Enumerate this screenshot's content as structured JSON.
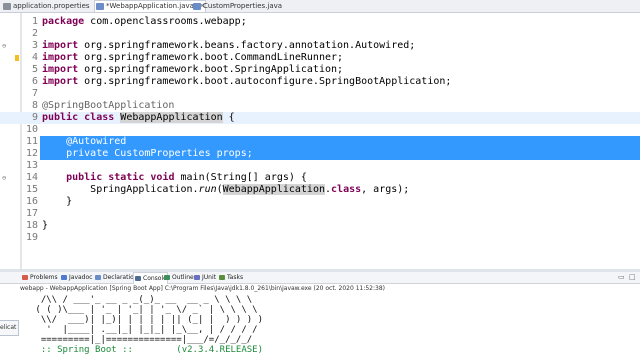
{
  "editor_tabs": [
    {
      "label": "application.properties",
      "icon": "properties-file-icon",
      "color": "#8a8f99"
    },
    {
      "label": "*WebappApplication.java",
      "icon": "java-file-icon",
      "color": "#6a8dc9"
    },
    {
      "label": "CustomProperties.java",
      "icon": "java-file-icon",
      "color": "#6a8dc9"
    }
  ],
  "tab_close_glyph": "✕",
  "code": {
    "l1": {
      "num": "1",
      "kw": "package",
      "rest": " com.openclassrooms.webapp;"
    },
    "l2": {
      "num": "2"
    },
    "l3": {
      "num": "3",
      "kw": "import",
      "rest": " org.springframework.beans.factory.annotation.Autowired;"
    },
    "l4": {
      "num": "4",
      "kw": "import",
      "rest": " org.springframework.boot.CommandLineRunner;"
    },
    "l5": {
      "num": "5",
      "kw": "import",
      "rest": " org.springframework.boot.SpringApplication;"
    },
    "l6": {
      "num": "6",
      "kw": "import",
      "rest": " org.springframework.boot.autoconfigure.SpringBootApplication;"
    },
    "l7": {
      "num": "7"
    },
    "l8": {
      "num": "8",
      "annotation": "@SpringBootApplication"
    },
    "l9": {
      "num": "9",
      "kw1": "public",
      "kw2": "class",
      "name": "WebappApplication",
      "rest": " {"
    },
    "l10": {
      "num": "10"
    },
    "l11": {
      "num": "11",
      "annotation": "@Autowired"
    },
    "l12": {
      "num": "12",
      "kw": "private",
      "type": " CustomProperties ",
      "field": "props",
      "rest": ";"
    },
    "l13": {
      "num": "13"
    },
    "l14": {
      "num": "14",
      "kw1": "public",
      "kw2": "static",
      "kw3": "void",
      "rest": " main(String[] args) {"
    },
    "l15": {
      "num": "15",
      "pre": "SpringApplication.",
      "method": "run",
      "paren": "(",
      "name": "WebappApplication",
      "kw": "class",
      "rest": ", args);"
    },
    "l16": {
      "num": "16",
      "text": "}"
    },
    "l17": {
      "num": "17"
    },
    "l18": {
      "num": "18",
      "text": "}"
    },
    "l19": {
      "num": "19"
    }
  },
  "view_tabs": [
    {
      "label": "Problems",
      "icon": "problems-icon",
      "color": "#d65b4a"
    },
    {
      "label": "Javadoc",
      "icon": "javadoc-icon",
      "color": "#4f7bd1"
    },
    {
      "label": "Declaration",
      "icon": "declaration-icon",
      "color": "#6a8dc9"
    },
    {
      "label": "Console",
      "icon": "console-icon",
      "color": "#4f6d94"
    },
    {
      "label": "Outline",
      "icon": "outline-icon",
      "color": "#3e8f5b"
    },
    {
      "label": "JUnit",
      "icon": "junit-icon",
      "color": "#6a6fbf"
    },
    {
      "label": "Tasks",
      "icon": "tasks-icon",
      "color": "#5a8f3e"
    }
  ],
  "console_header": "webapp - WebappApplication [Spring Boot App] C:\\Program Files\\Java\\jdk1.8.0_261\\bin\\javaw.exe  (20 oct. 2020 11:52:38)",
  "console_lines": [
    "  /\\\\ / ___'_ __ _ _(_)_ __  __ _ \\ \\ \\ \\",
    " ( ( )\\___ | '_ | '_| | '_ \\/ _` | \\ \\ \\ \\",
    "  \\\\/  ___)| |_)| | | | | || (_| |  ) ) ) )",
    "   '  |____| .__|_| |_|_| |_\\__, | / / / /",
    "  =========|_|==============|___/=/_/_/_/",
    "  :: Spring Boot ::        (v2.3.4.RELEASE)"
  ],
  "side_clip_label": "elicat",
  "colors": {
    "selection": "#3399ff",
    "keyword": "#7f0055",
    "current_line": "#e8f2fe"
  }
}
